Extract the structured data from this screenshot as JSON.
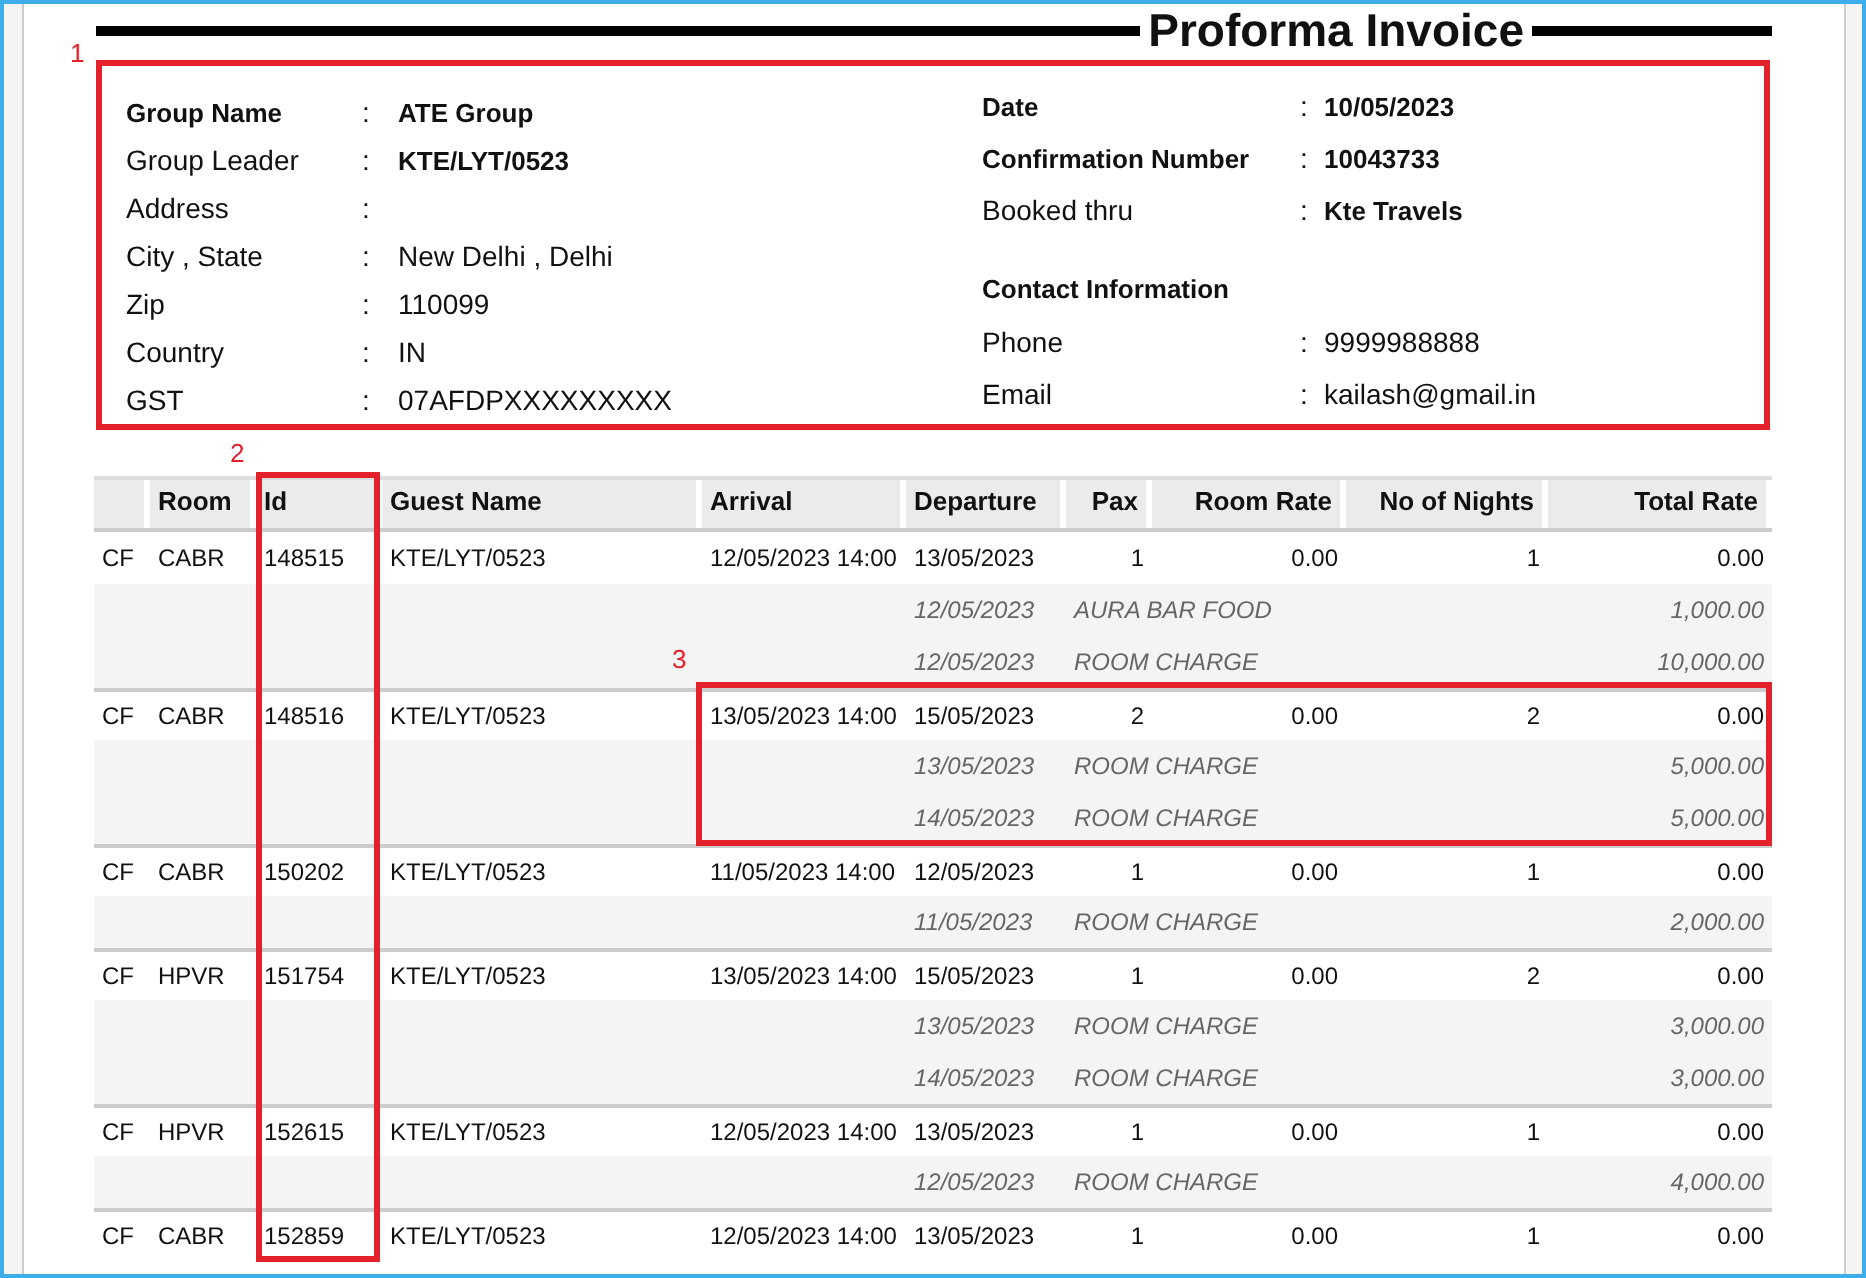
{
  "title": "Proforma Invoice",
  "group_info": [
    {
      "label": "Group Name",
      "separator": ":",
      "value": "ATE Group",
      "label_bold": true,
      "value_bold": true
    },
    {
      "label": "Group Leader",
      "separator": ":",
      "value": "KTE/LYT/0523",
      "label_bold": false,
      "value_bold": true
    },
    {
      "label": "Address",
      "separator": ":",
      "label_bold": false
    },
    {
      "label": "City , State",
      "separator": ":",
      "value": "New Delhi , Delhi",
      "label_bold": false,
      "value_bold": false
    },
    {
      "label": "Zip",
      "separator": ":",
      "value": "110099",
      "label_bold": false,
      "value_bold": false
    },
    {
      "label": "Country",
      "separator": ":",
      "value": "IN",
      "label_bold": false,
      "value_bold": false
    },
    {
      "label": "GST",
      "separator": ":",
      "value": "07AFDPXXXXXXXXX",
      "label_bold": false,
      "value_bold": false
    }
  ],
  "booking_info": [
    {
      "label": "Date",
      "separator": ":",
      "value": "10/05/2023",
      "label_bold": true,
      "value_bold": true
    },
    {
      "label": "Confirmation Number",
      "separator": ":",
      "value": "10043733",
      "label_bold": true,
      "value_bold": true
    },
    {
      "label": "Booked thru",
      "separator": ":",
      "value": "Kte Travels",
      "label_bold": false,
      "value_bold": true
    }
  ],
  "contact": {
    "heading": "Contact Information",
    "fields": [
      {
        "label": "Phone",
        "separator": ":",
        "value": "9999988888",
        "label_bold": false,
        "value_bold": false
      },
      {
        "label": "Email",
        "separator": ":",
        "value": "kailash@gmail.in",
        "label_bold": false,
        "value_bold": false
      }
    ]
  },
  "table": {
    "columns": [
      "",
      "Room",
      "Id",
      "Guest Name",
      "Arrival",
      "Departure",
      "Pax",
      "Room Rate",
      "No of Nights",
      "Total Rate"
    ],
    "rows": [
      {
        "type": "CF",
        "room": "CABR",
        "id": "148515",
        "guest": "KTE/LYT/0523",
        "arrival": "12/05/2023 14:00",
        "departure": "13/05/2023",
        "pax": "1",
        "room_rate": "0.00",
        "nights": "1",
        "total_rate": "0.00",
        "charges": [
          {
            "date": "12/05/2023",
            "description": "AURA BAR FOOD",
            "amount": "1,000.00"
          },
          {
            "date": "12/05/2023",
            "description": "ROOM CHARGE",
            "amount": "10,000.00"
          }
        ]
      },
      {
        "type": "CF",
        "room": "CABR",
        "id": "148516",
        "guest": "KTE/LYT/0523",
        "arrival": "13/05/2023 14:00",
        "departure": "15/05/2023",
        "pax": "2",
        "room_rate": "0.00",
        "nights": "2",
        "total_rate": "0.00",
        "charges": [
          {
            "date": "13/05/2023",
            "description": "ROOM CHARGE",
            "amount": "5,000.00"
          },
          {
            "date": "14/05/2023",
            "description": "ROOM CHARGE",
            "amount": "5,000.00"
          }
        ]
      },
      {
        "type": "CF",
        "room": "CABR",
        "id": "150202",
        "guest": "KTE/LYT/0523",
        "arrival": "11/05/2023 14:00",
        "departure": "12/05/2023",
        "pax": "1",
        "room_rate": "0.00",
        "nights": "1",
        "total_rate": "0.00",
        "charges": [
          {
            "date": "11/05/2023",
            "description": "ROOM CHARGE",
            "amount": "2,000.00"
          }
        ]
      },
      {
        "type": "CF",
        "room": "HPVR",
        "id": "151754",
        "guest": "KTE/LYT/0523",
        "arrival": "13/05/2023 14:00",
        "departure": "15/05/2023",
        "pax": "1",
        "room_rate": "0.00",
        "nights": "2",
        "total_rate": "0.00",
        "charges": [
          {
            "date": "13/05/2023",
            "description": "ROOM CHARGE",
            "amount": "3,000.00"
          },
          {
            "date": "14/05/2023",
            "description": "ROOM CHARGE",
            "amount": "3,000.00"
          }
        ]
      },
      {
        "type": "CF",
        "room": "HPVR",
        "id": "152615",
        "guest": "KTE/LYT/0523",
        "arrival": "12/05/2023 14:00",
        "departure": "13/05/2023",
        "pax": "1",
        "room_rate": "0.00",
        "nights": "1",
        "total_rate": "0.00",
        "charges": [
          {
            "date": "12/05/2023",
            "description": "ROOM CHARGE",
            "amount": "4,000.00"
          }
        ]
      },
      {
        "type": "CF",
        "room": "CABR",
        "id": "152859",
        "guest": "KTE/LYT/0523",
        "arrival": "12/05/2023 14:00",
        "departure": "13/05/2023",
        "pax": "1",
        "room_rate": "0.00",
        "nights": "1",
        "total_rate": "0.00"
      }
    ]
  },
  "annotations": [
    {
      "label": "1"
    },
    {
      "label": "2"
    },
    {
      "label": "3"
    }
  ]
}
